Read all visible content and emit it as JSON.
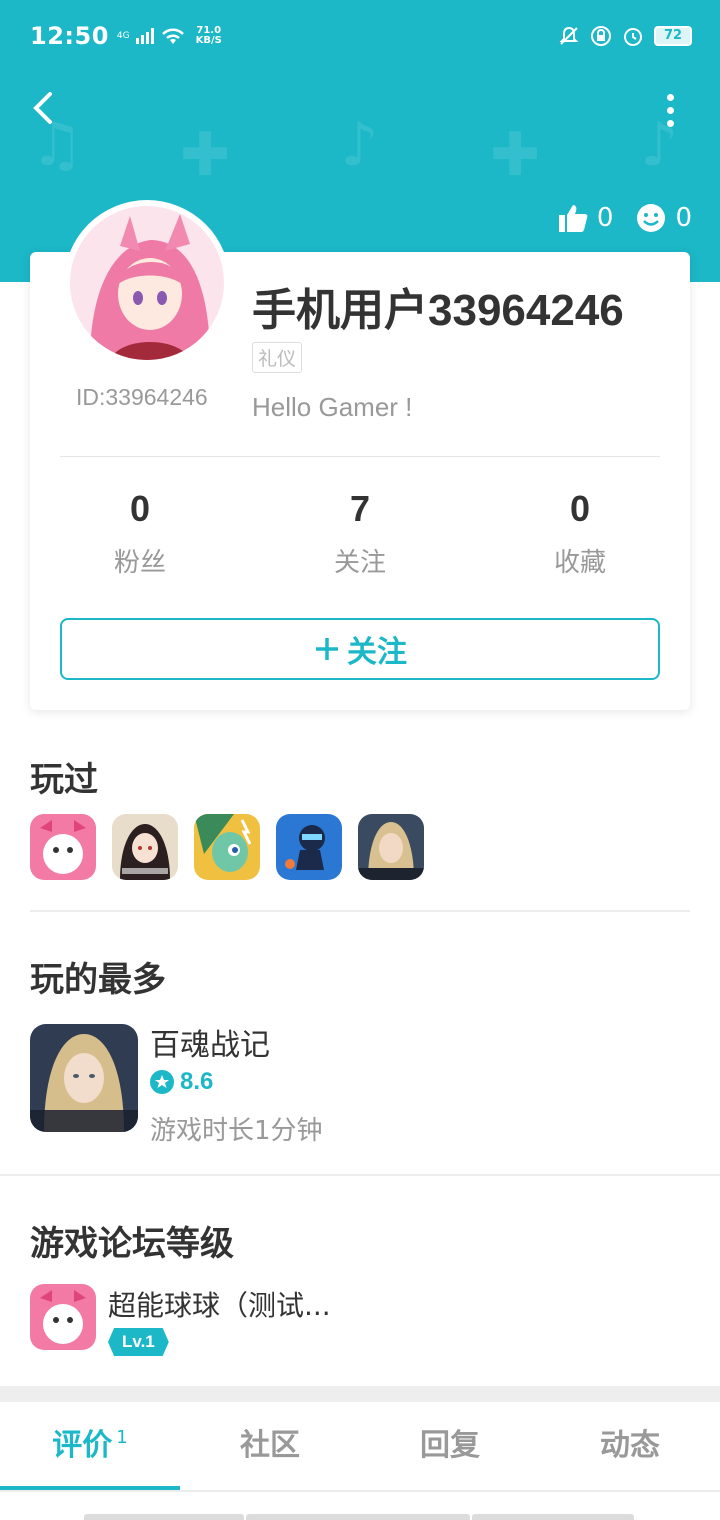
{
  "status_bar": {
    "time": "12:50",
    "network": "4G",
    "speed_value": "71.0",
    "speed_unit": "KB/S",
    "battery": "72"
  },
  "header": {
    "likes_count": "0",
    "smiles_count": "0"
  },
  "profile": {
    "username": "手机用户33964246",
    "user_id": "ID:33964246",
    "tag": "礼仪",
    "bio": "Hello Gamer !",
    "counts": [
      {
        "value": "0",
        "label": "粉丝"
      },
      {
        "value": "7",
        "label": "关注"
      },
      {
        "value": "0",
        "label": "收藏"
      }
    ],
    "follow_label": "关注"
  },
  "played": {
    "title": "玩过"
  },
  "most_played": {
    "title": "玩的最多",
    "game_name": "百魂战记",
    "score": "8.6",
    "playtime": "游戏时长1分钟"
  },
  "forum_level": {
    "title": "游戏论坛等级",
    "game_name": "超能球球（测试...",
    "level": "Lv.1"
  },
  "tabs": [
    {
      "label": "评价",
      "count": "1"
    },
    {
      "label": "社区"
    },
    {
      "label": "回复"
    },
    {
      "label": "动态"
    }
  ],
  "colors": {
    "accent": "#1cb8c8",
    "text_primary": "#333333",
    "text_secondary": "#999999"
  }
}
